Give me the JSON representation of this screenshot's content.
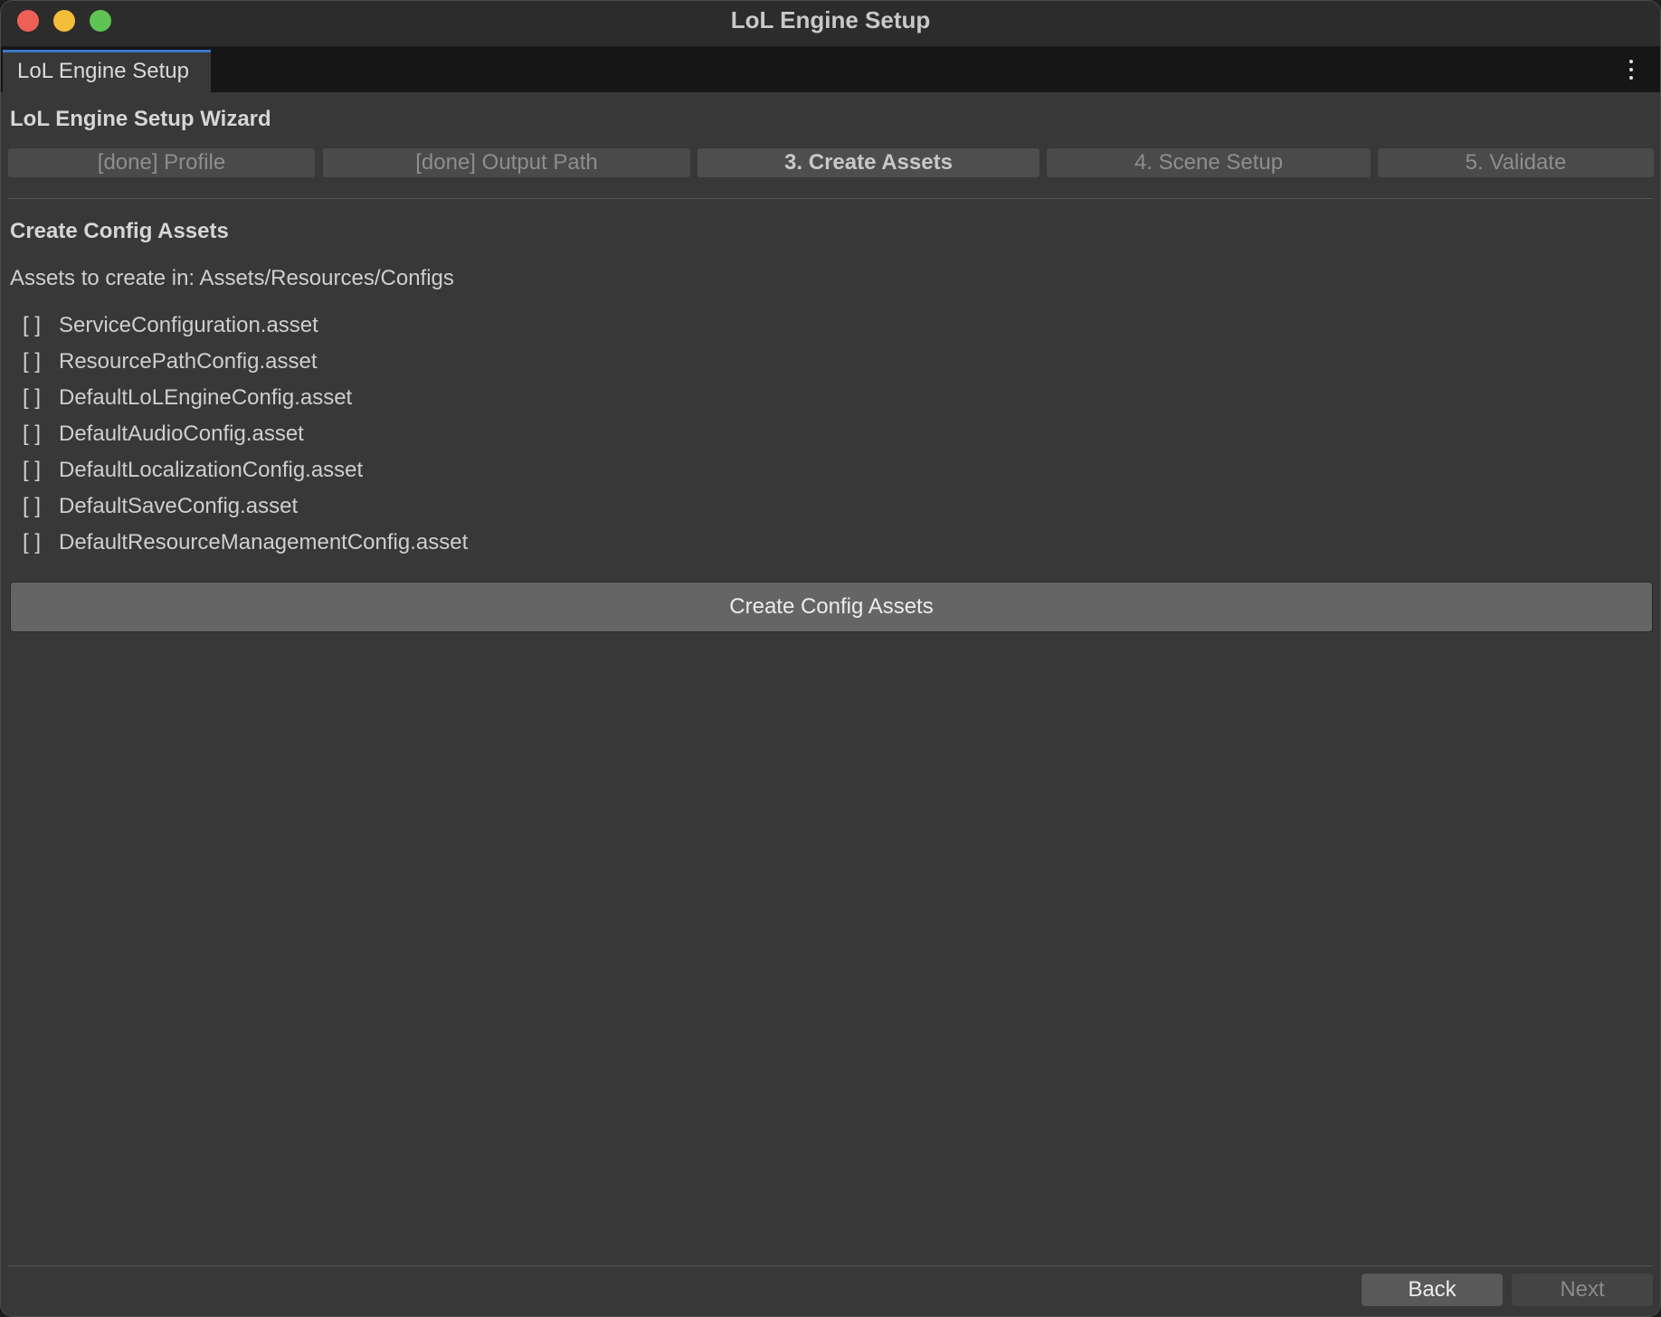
{
  "window": {
    "title": "LoL Engine Setup"
  },
  "tab": {
    "label": "LoL Engine Setup"
  },
  "wizard": {
    "title": "LoL Engine Setup Wizard",
    "steps": [
      {
        "label": "[done] Profile",
        "state": "done"
      },
      {
        "label": "[done] Output Path",
        "state": "done"
      },
      {
        "label": "3. Create Assets",
        "state": "active"
      },
      {
        "label": "4. Scene Setup",
        "state": "pending"
      },
      {
        "label": "5. Validate",
        "state": "pending"
      }
    ]
  },
  "section": {
    "title": "Create Config Assets",
    "path_text": "Assets to create in: Assets/Resources/Configs",
    "checkbox_glyph": "[ ]",
    "assets": [
      "ServiceConfiguration.asset",
      "ResourcePathConfig.asset",
      "DefaultLoLEngineConfig.asset",
      "DefaultAudioConfig.asset",
      "DefaultLocalizationConfig.asset",
      "DefaultSaveConfig.asset",
      "DefaultResourceManagementConfig.asset"
    ],
    "create_button": "Create Config Assets"
  },
  "footer": {
    "back_label": "Back",
    "next_label": "Next"
  },
  "colors": {
    "window_bg": "#383838",
    "tab_accent": "#3a78c8",
    "close": "#ee5f57",
    "minimize": "#f4bd3a",
    "maximize": "#5fc453"
  }
}
